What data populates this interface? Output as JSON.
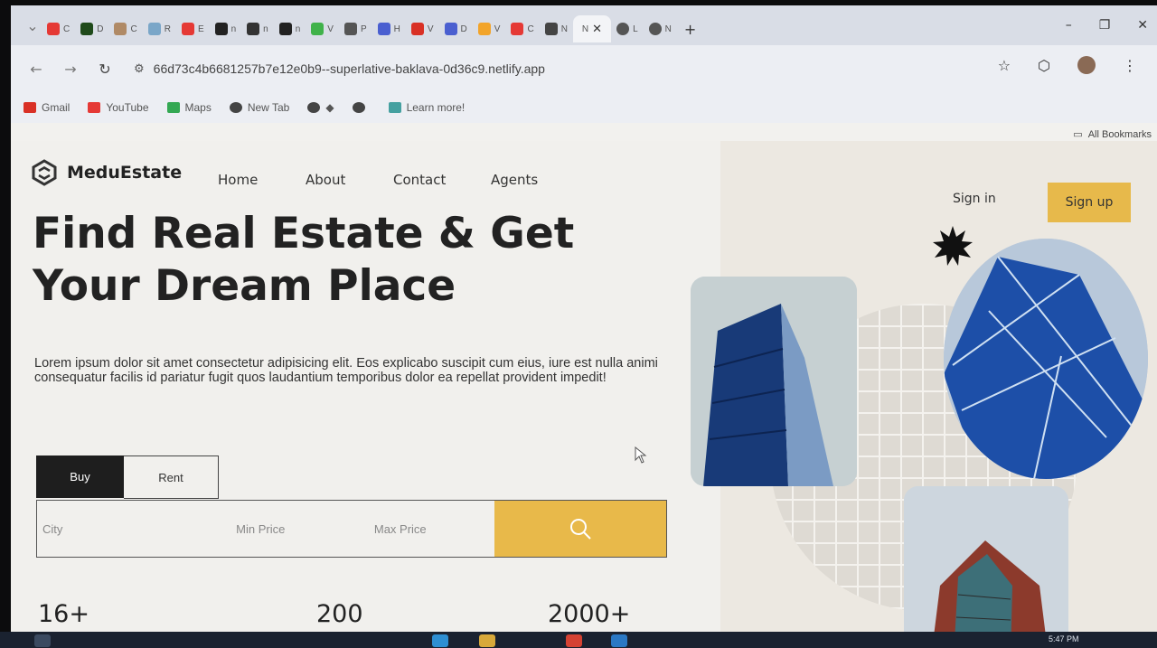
{
  "browser": {
    "tabs": [
      {
        "icon": "youtube-icon",
        "label": "C",
        "color": "#e53935"
      },
      {
        "icon": "dark-circle-icon",
        "label": "D",
        "color": "#1f4a1a"
      },
      {
        "icon": "cookie-icon",
        "label": "C",
        "color": "#b08a66"
      },
      {
        "icon": "globe-icon",
        "label": "R",
        "color": "#7aa6c8"
      },
      {
        "icon": "youtube-icon",
        "label": "E",
        "color": "#e53935"
      },
      {
        "icon": "github-icon",
        "label": "n",
        "color": "#222222"
      },
      {
        "icon": "github-icon",
        "label": "n",
        "color": "#333333"
      },
      {
        "icon": "github-icon",
        "label": "n",
        "color": "#222222"
      },
      {
        "icon": "play-icon",
        "label": "V",
        "color": "#40b24a"
      },
      {
        "icon": "globe-icon",
        "label": "P",
        "color": "#555555"
      },
      {
        "icon": "s-icon",
        "label": "H",
        "color": "#4a5fd0"
      },
      {
        "icon": "gmail-icon",
        "label": "V",
        "color": "#d93025"
      },
      {
        "icon": "s-icon",
        "label": "D",
        "color": "#4a5fd0"
      },
      {
        "icon": "v-icon",
        "label": "V",
        "color": "#f2a42a"
      },
      {
        "icon": "youtube-icon",
        "label": "C",
        "color": "#e53935"
      },
      {
        "icon": "circle-icon",
        "label": "N",
        "color": "#444444"
      }
    ],
    "active_tab": {
      "label": "N"
    },
    "extra_tabs": [
      {
        "icon": "globe-icon",
        "label": "L",
        "color": "#555555"
      },
      {
        "icon": "globe-icon",
        "label": "N",
        "color": "#555555"
      }
    ],
    "url": "66d73c4b6681257b7e12e0b9--superlative-baklava-0d36c9.netlify.app",
    "bookmarks": [
      {
        "icon": "gmail-icon",
        "label": "Gmail",
        "color": "#d93025"
      },
      {
        "icon": "youtube-icon",
        "label": "YouTube",
        "color": "#e53935"
      },
      {
        "icon": "maps-icon",
        "label": "Maps",
        "color": "#34a853"
      },
      {
        "icon": "globe-icon",
        "label": "New Tab",
        "color": "#444444"
      },
      {
        "icon": "globe-icon",
        "label": "◆",
        "color": "#444444"
      },
      {
        "icon": "globe-icon",
        "label": "",
        "color": "#444444"
      },
      {
        "icon": "sparkle-icon",
        "label": "Learn more!",
        "color": "#45a0a0"
      }
    ],
    "all_bookmarks": "All Bookmarks"
  },
  "site": {
    "logo": "MeduEstate",
    "nav": [
      "Home",
      "About",
      "Contact",
      "Agents"
    ],
    "sign_in": "Sign in",
    "sign_up": "Sign up",
    "hero_title": "Find Real Estate & Get Your Dream Place",
    "hero_desc": "Lorem ipsum dolor sit amet consectetur adipisicing elit. Eos explicabo suscipit cum eius, iure est nulla animi consequatur facilis id pariatur fugit quos laudantium temporibus dolor ea repellat provident impedit!",
    "tabs": {
      "buy": "Buy",
      "rent": "Rent"
    },
    "search": {
      "city": "City",
      "min_price": "Min Price",
      "max_price": "Max Price"
    },
    "stats": [
      "16+",
      "200",
      "2000+"
    ],
    "accent_color": "#e8b94a"
  },
  "taskbar": {
    "time": "5:47 PM"
  }
}
